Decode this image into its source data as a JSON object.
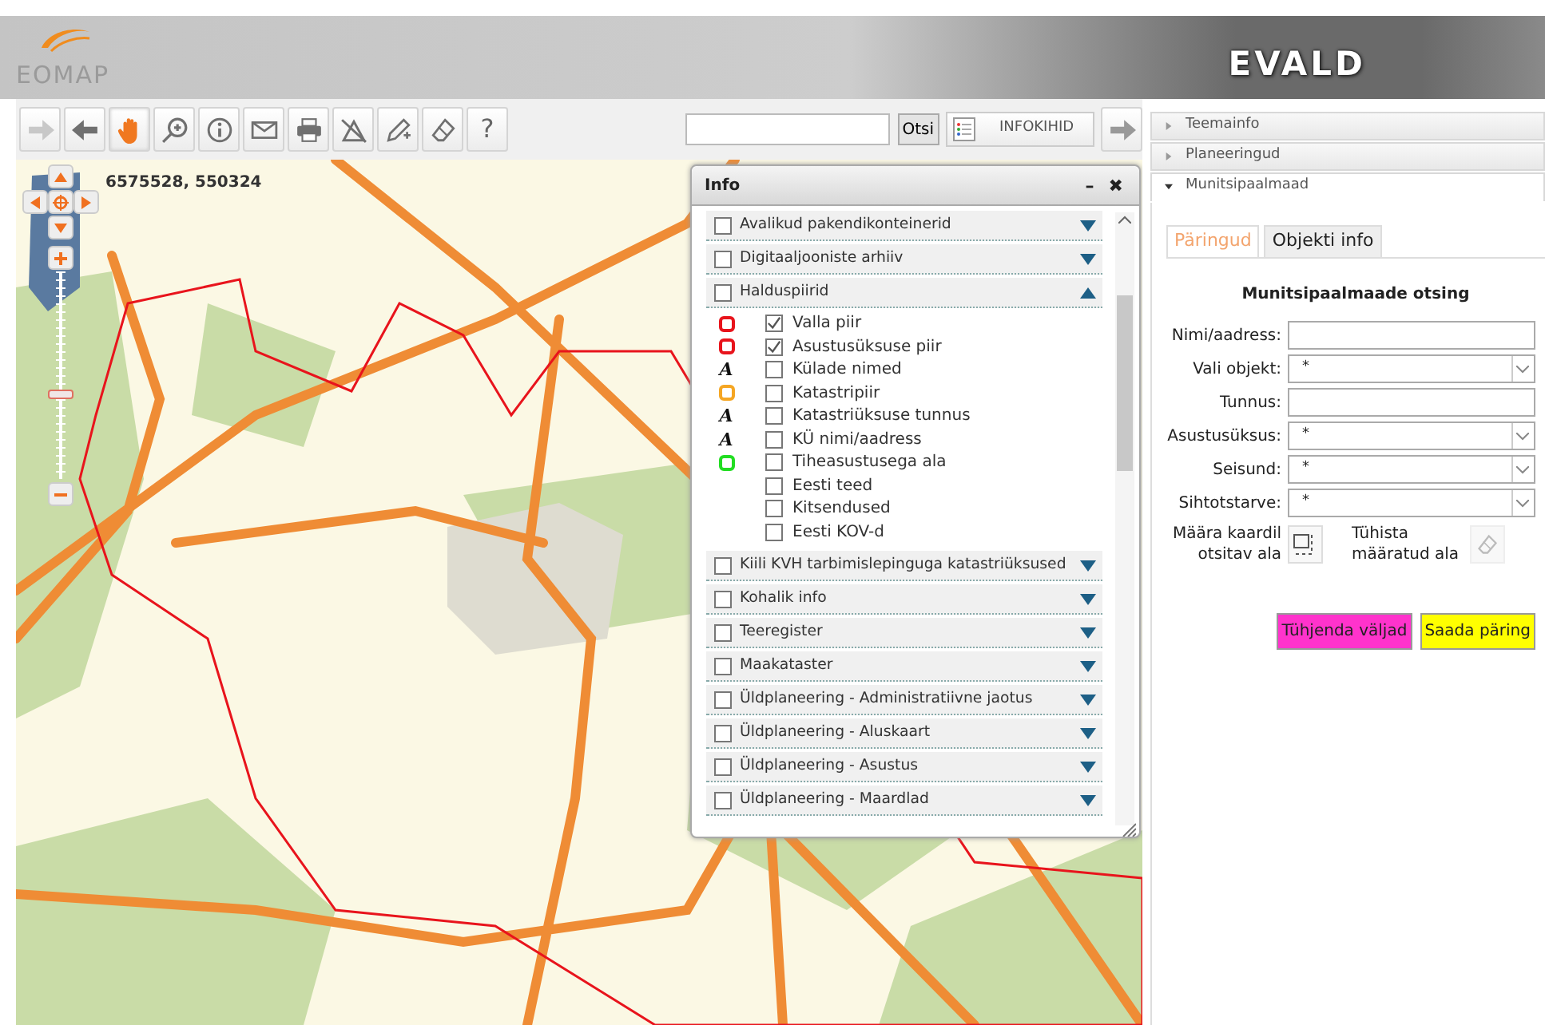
{
  "header": {
    "logo": "EOMAP",
    "app_title": "EVALD"
  },
  "toolbar": {
    "tools": [
      {
        "kind": "forward",
        "disabled": true,
        "selected": false
      },
      {
        "kind": "back",
        "disabled": false,
        "selected": false
      },
      {
        "kind": "pan",
        "disabled": false,
        "selected": true
      },
      {
        "kind": "zoom",
        "disabled": false,
        "selected": false
      },
      {
        "kind": "info",
        "disabled": false,
        "selected": false
      },
      {
        "kind": "mail",
        "disabled": false,
        "selected": false
      },
      {
        "kind": "print",
        "disabled": false,
        "selected": false
      },
      {
        "kind": "measure",
        "disabled": false,
        "selected": false
      },
      {
        "kind": "draw",
        "disabled": false,
        "selected": false
      },
      {
        "kind": "erase",
        "disabled": false,
        "selected": false
      },
      {
        "kind": "help",
        "disabled": false,
        "selected": false,
        "label": "?"
      }
    ],
    "search_button": "Otsi",
    "layers_button": "INFOKIHID"
  },
  "map": {
    "coordinates": "6575528, 550324",
    "zoom": {
      "level": 0.4
    }
  },
  "info_panel": {
    "title": "Info",
    "minimize": "–",
    "close": "✖",
    "groups": [
      {
        "label": "Avalikud pakendikonteinerid",
        "checked": false,
        "expanded": false
      },
      {
        "label": "Digitaaljooniste arhiiv",
        "checked": false,
        "expanded": false
      },
      {
        "label": "Halduspiirid",
        "checked": false,
        "expanded": true,
        "children": [
          {
            "label": "Valla piir",
            "checked": true,
            "symbol": {
              "kind": "ring",
              "color": "#e8141c"
            }
          },
          {
            "label": "Asustusüksuse piir",
            "checked": true,
            "symbol": {
              "kind": "ring",
              "color": "#e8141c"
            }
          },
          {
            "label": "Külade nimed",
            "checked": false,
            "symbol": {
              "kind": "letter",
              "text": "A"
            }
          },
          {
            "label": "Katastripiir",
            "checked": false,
            "symbol": {
              "kind": "ring",
              "color": "#f5a623"
            }
          },
          {
            "label": "Katastriüksuse tunnus",
            "checked": false,
            "symbol": {
              "kind": "letter",
              "text": "A"
            }
          },
          {
            "label": "KÜ nimi/aadress",
            "checked": false,
            "symbol": {
              "kind": "letter",
              "text": "A"
            }
          },
          {
            "label": "Tiheasustusega ala",
            "checked": false,
            "symbol": {
              "kind": "ring",
              "color": "#22dd22"
            }
          },
          {
            "label": "Eesti teed",
            "checked": false
          },
          {
            "label": "Kitsendused",
            "checked": false
          },
          {
            "label": "Eesti KOV-d",
            "checked": false
          }
        ]
      },
      {
        "label": "Kiili KVH tarbimislepinguga katastriüksused",
        "checked": false,
        "expanded": false
      },
      {
        "label": "Kohalik info",
        "checked": false,
        "expanded": false
      },
      {
        "label": "Teeregister",
        "checked": false,
        "expanded": false
      },
      {
        "label": "Maakataster",
        "checked": false,
        "expanded": false
      },
      {
        "label": "Üldplaneering - Administratiivne jaotus",
        "checked": false,
        "expanded": false
      },
      {
        "label": "Üldplaneering - Aluskaart",
        "checked": false,
        "expanded": false
      },
      {
        "label": "Üldplaneering - Asustus",
        "checked": false,
        "expanded": false
      },
      {
        "label": "Üldplaneering - Maardlad",
        "checked": false,
        "expanded": false
      }
    ]
  },
  "right_panel": {
    "sections": [
      {
        "label": "Teemainfo",
        "expanded": false
      },
      {
        "label": "Planeeringud",
        "expanded": false
      },
      {
        "label": "Munitsipaalmaad",
        "expanded": true
      }
    ],
    "tabs": [
      {
        "label": "Päringud",
        "selected": true
      },
      {
        "label": "Objekti info",
        "selected": false
      }
    ],
    "form": {
      "title": "Munitsipaalmaade otsing",
      "fields": [
        {
          "label": "Nimi/aadress:",
          "kind": "text"
        },
        {
          "label": "Vali objekt:",
          "kind": "select",
          "value": "*"
        },
        {
          "label": "Tunnus:",
          "kind": "text"
        },
        {
          "label": "Asustusüksus:",
          "kind": "select",
          "value": "*"
        },
        {
          "label": "Seisund:",
          "kind": "select",
          "value": "*"
        },
        {
          "label": "Sihtotstarve:",
          "kind": "select",
          "value": "*"
        }
      ],
      "area_select": "Määra kaardil otsitav ala",
      "area_clear": "Tühista määratud ala",
      "buttons": [
        {
          "label": "Tühjenda väljad",
          "color": "#ff33cc"
        },
        {
          "label": "Saada päring",
          "color": "#ffff00"
        }
      ]
    }
  }
}
